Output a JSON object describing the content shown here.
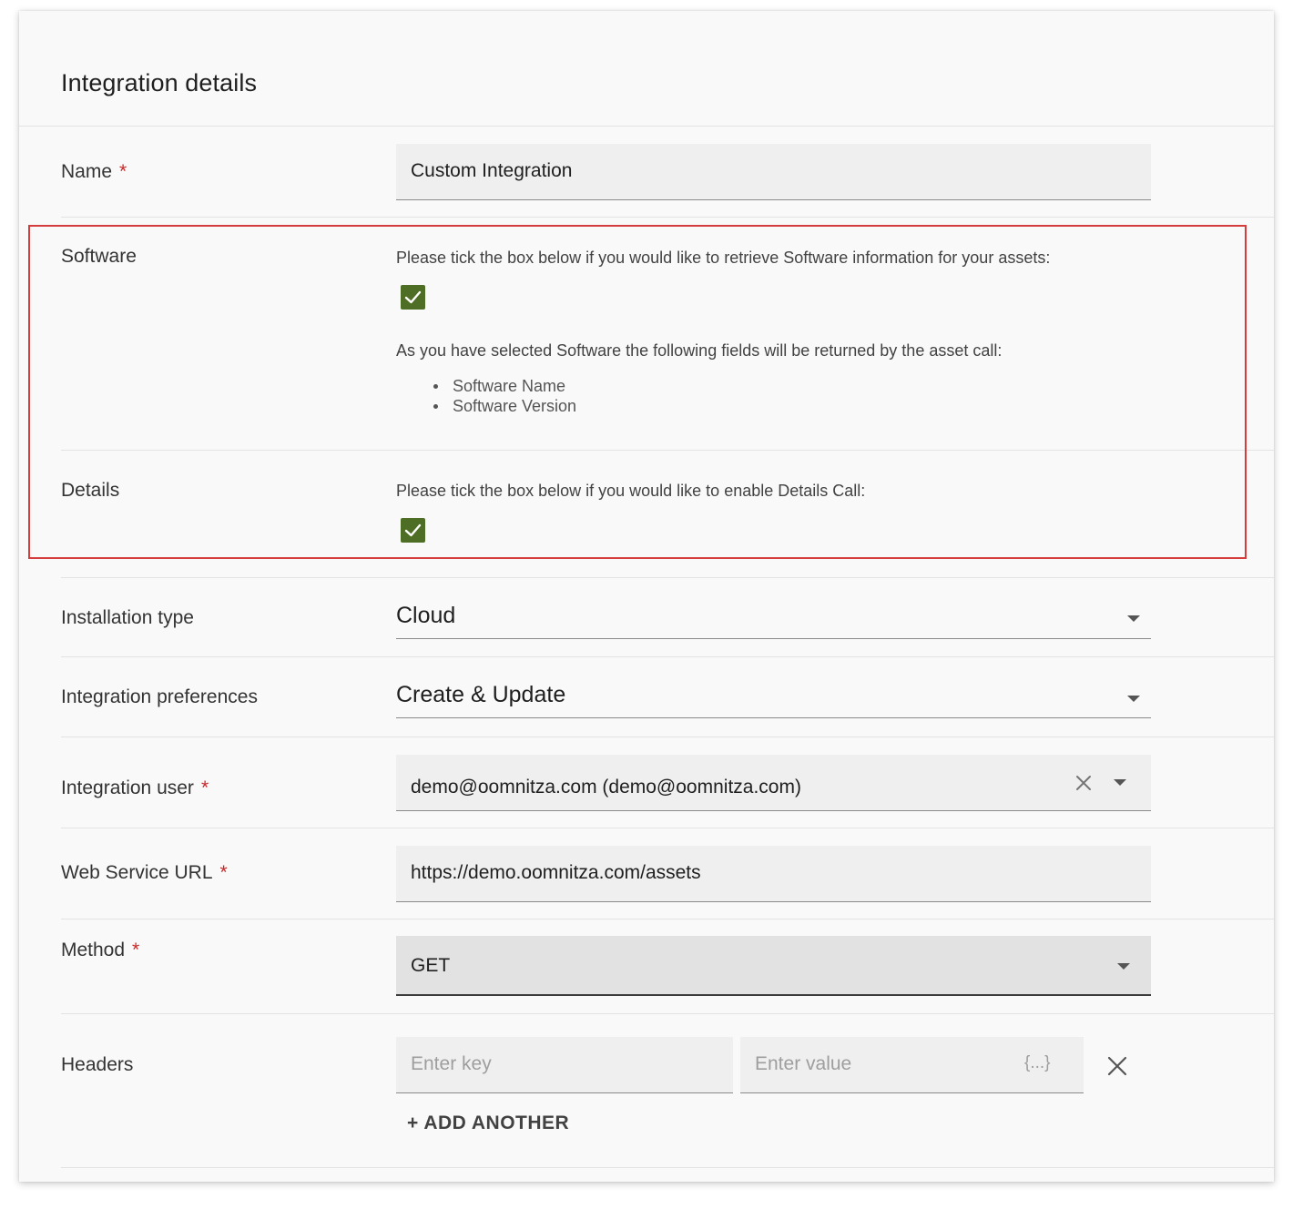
{
  "title": "Integration details",
  "required_mark": "*",
  "fields": {
    "name": {
      "label": "Name",
      "value": "Custom Integration"
    },
    "software": {
      "label": "Software",
      "help": "Please tick the box below if you would like to retrieve Software information for your assets:",
      "checked": true,
      "selected_note": "As you have selected Software the following fields will be returned by the asset call:",
      "returned_fields": [
        "Software Name",
        "Software Version"
      ]
    },
    "details": {
      "label": "Details",
      "help": "Please tick the box below if you would like to enable Details Call:",
      "checked": true
    },
    "installation_type": {
      "label": "Installation type",
      "value": "Cloud"
    },
    "integration_preferences": {
      "label": "Integration preferences",
      "value": "Create & Update"
    },
    "integration_user": {
      "label": "Integration user",
      "value": "demo@oomnitza.com (demo@oomnitza.com)"
    },
    "web_service_url": {
      "label": "Web Service URL",
      "value": "https://demo.oomnitza.com/assets"
    },
    "method": {
      "label": "Method",
      "value": "GET"
    },
    "headers": {
      "label": "Headers",
      "key_placeholder": "Enter key",
      "value_placeholder": "Enter value",
      "value_hint": "{...}",
      "add_another": "+ ADD ANOTHER"
    }
  },
  "colors": {
    "checkbox": "#4f6e25",
    "highlight": "#d53c3c",
    "required": "#c62828"
  },
  "icons": [
    "check-icon",
    "chevron-down-icon",
    "close-icon"
  ]
}
